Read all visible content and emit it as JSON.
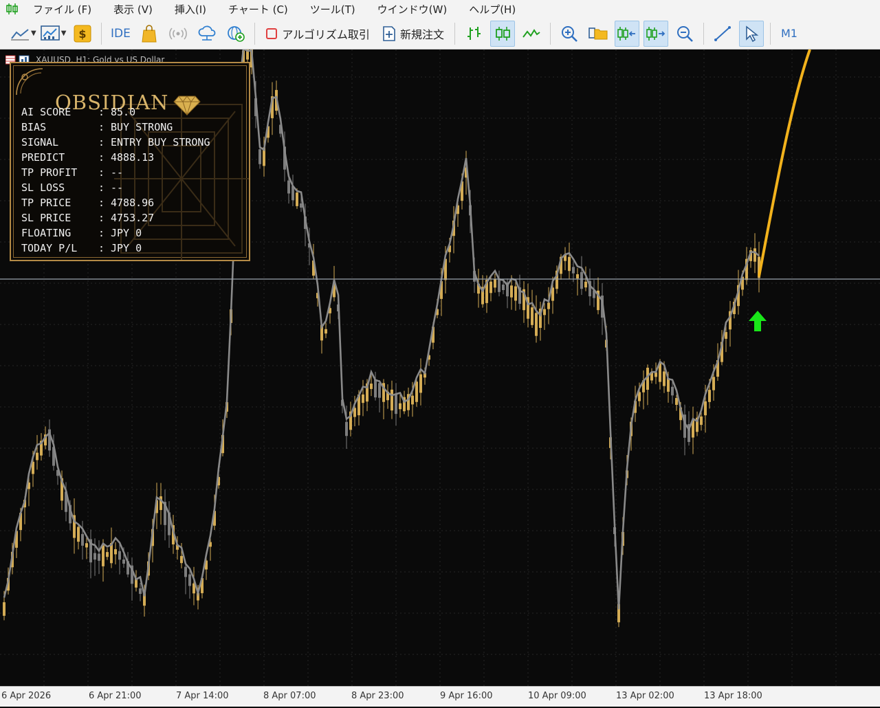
{
  "menu": {
    "items": [
      "ファイル (F)",
      "表示 (V)",
      "挿入(I)",
      "チャート (C)",
      "ツール(T)",
      "ウインドウ(W)",
      "ヘルプ(H)"
    ]
  },
  "toolbar": {
    "ide_label": "IDE",
    "algo_trading_label": "アルゴリズム取引",
    "new_order_label": "新規注文",
    "timeframe_label": "M1"
  },
  "chart": {
    "tab_title": "XAUUSD, H1:  Gold vs US Dollar",
    "x_labels": [
      "6 Apr 2026",
      "6 Apr 21:00",
      "7 Apr 14:00",
      "8 Apr 07:00",
      "8 Apr 23:00",
      "9 Apr 16:00",
      "10 Apr 09:00",
      "13 Apr 02:00",
      "13 Apr 18:00"
    ],
    "colors": {
      "background": "#0a0a0a",
      "bull_candle": "#d4ac55",
      "bear_candle": "#7d7d7d",
      "overlay_line": "#8a8a8a",
      "forecast_line": "#f2b21c",
      "price_line": "#9aa3ad",
      "signal_arrow": "#19e619"
    }
  },
  "panel": {
    "title": "OBSIDIAN",
    "icon": "diamond-icon",
    "rows": [
      {
        "label": "AI SCORE",
        "value": "85.0"
      },
      {
        "label": "BIAS",
        "value": "BUY STRONG"
      },
      {
        "label": "SIGNAL",
        "value": "ENTRY BUY STRONG"
      },
      {
        "label": "PREDICT",
        "value": "4888.13"
      },
      {
        "label": "TP PROFIT",
        "value": "--"
      },
      {
        "label": "SL LOSS",
        "value": "--"
      },
      {
        "label": "TP PRICE",
        "value": "4788.96"
      },
      {
        "label": "SL PRICE",
        "value": "4753.27"
      },
      {
        "label": "FLOATING",
        "value": "JPY 0"
      },
      {
        "label": "TODAY P/L",
        "value": "JPY 0"
      }
    ]
  }
}
